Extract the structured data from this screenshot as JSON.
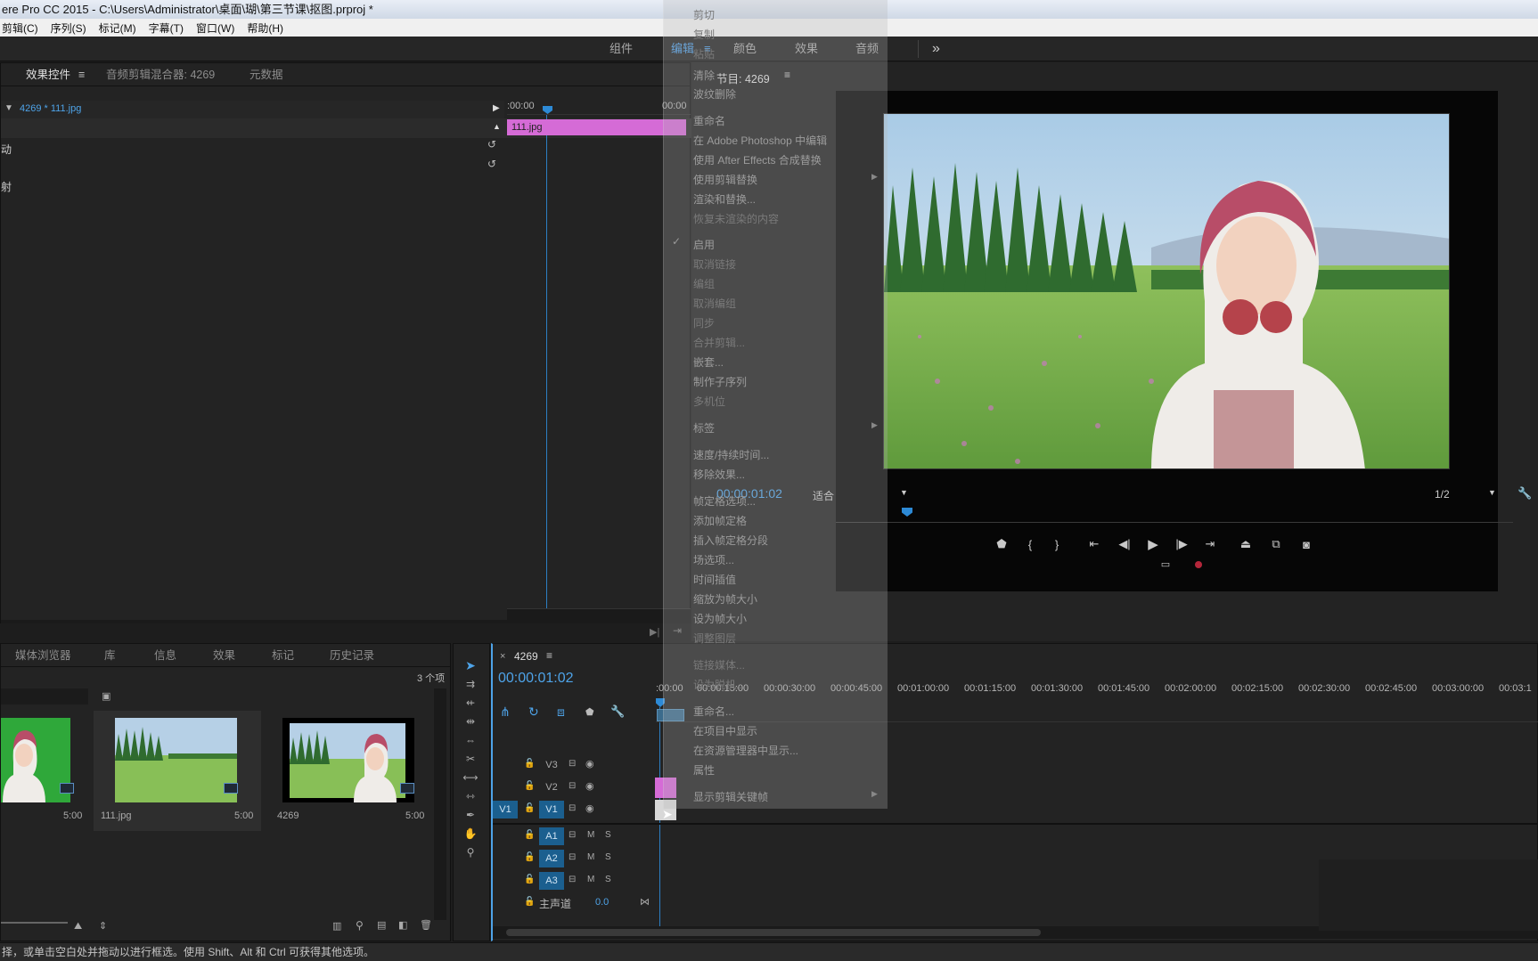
{
  "window": {
    "title": "ere Pro CC 2015 - C:\\Users\\Administrator\\桌面\\瑚\\第三节课\\抠图.prproj *"
  },
  "menu": {
    "items": [
      "剪辑(C)",
      "序列(S)",
      "标记(M)",
      "字幕(T)",
      "窗口(W)",
      "帮助(H)"
    ]
  },
  "workspaces": {
    "tabs": [
      "组件",
      "编辑",
      "颜色",
      "效果",
      "音频"
    ],
    "active": "编辑",
    "more": "»"
  },
  "effect_controls": {
    "tabs": [
      "效果控件",
      "音频剪辑混合器: 4269",
      "元数据"
    ],
    "clip_label": "4269 * 111.jpg",
    "time_start": ":00:00",
    "time_end": "00:00",
    "clip_name": "111.jpg",
    "row1_fragment": "动",
    "row2_fragment": "射",
    "colors": {
      "clip": "#d56bd6"
    }
  },
  "program_monitor": {
    "title": "节目: 4269",
    "timecode": "00:00:01:02",
    "fit_value": "适合",
    "resolution": "1/2"
  },
  "project_panel": {
    "tabs": [
      "媒体浏览器",
      "库",
      "信息",
      "效果",
      "标记",
      "历史记录"
    ],
    "item_count": "3 个项",
    "items": [
      {
        "name": "",
        "duration": "5:00"
      },
      {
        "name": "111.jpg",
        "duration": "5:00"
      },
      {
        "name": "4269",
        "duration": "5:00"
      }
    ]
  },
  "timeline": {
    "tab": "4269",
    "timecode": "00:00:01:02",
    "ruler": [
      ":00:00",
      "00:00:15:00",
      "00:00:30:00",
      "00:00:45:00",
      "00:01:00:00",
      "00:01:15:00",
      "00:01:30:00",
      "00:01:45:00",
      "00:02:00:00",
      "00:02:15:00",
      "00:02:30:00",
      "00:02:45:00",
      "00:03:00:00",
      "00:03:1"
    ],
    "video_tracks": [
      "V3",
      "V2",
      "V1"
    ],
    "audio_tracks": [
      "A1",
      "A2",
      "A3"
    ],
    "source_patch": "V1",
    "master_label": "主声道",
    "master_value": "0.0",
    "mute_label": "M",
    "solo_label": "S"
  },
  "context_menu": {
    "items": [
      "剪切",
      "复制",
      "粘贴",
      "清除",
      "波纹删除",
      "重命名",
      "在 Adobe Photoshop 中编辑",
      "使用 After Effects 合成替换",
      "使用剪辑替换",
      "渲染和替换...",
      "恢复未渲染的内容",
      "启用",
      "取消链接",
      "编组",
      "取消编组",
      "同步",
      "合并剪辑...",
      "嵌套...",
      "制作子序列",
      "多机位",
      "标签",
      "速度/持续时间...",
      "移除效果...",
      "帧定格选项...",
      "添加帧定格",
      "插入帧定格分段",
      "场选项...",
      "时间插值",
      "缩放为帧大小",
      "设为帧大小",
      "调整图层",
      "链接媒体...",
      "设为脱机...",
      "重命名...",
      "在项目中显示",
      "在资源管理器中显示...",
      "属性",
      "显示剪辑关键帧"
    ]
  },
  "status_bar": {
    "text": "择，或单击空白处并拖动以进行框选。使用 Shift、Alt 和 Ctrl 可获得其他选项。"
  },
  "colors": {
    "accent": "#4ea3e8",
    "clip_pink": "#d56bd6",
    "panel_bg": "#232323",
    "track_blue": "#1b5f8f"
  }
}
